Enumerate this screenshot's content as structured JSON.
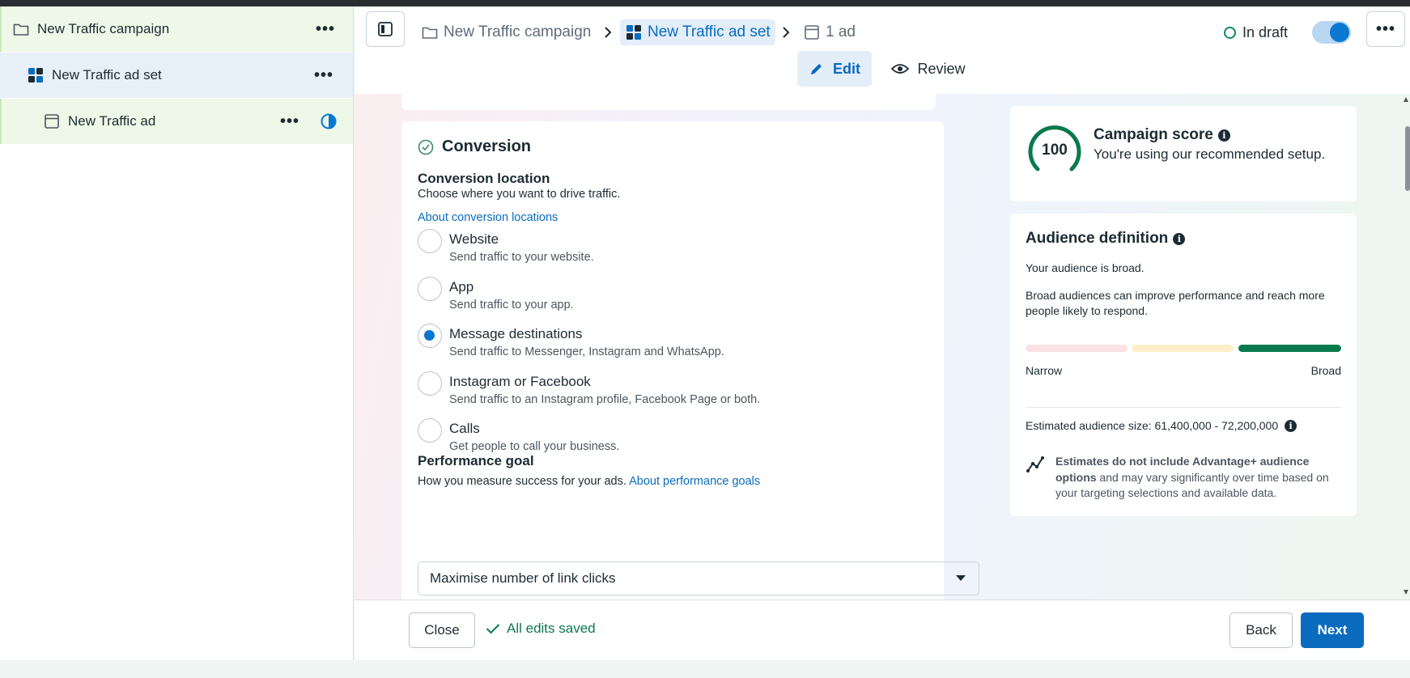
{
  "sidebar": {
    "items": [
      {
        "label": "New Traffic campaign",
        "icon": "folder-icon"
      },
      {
        "label": "New Traffic ad set",
        "icon": "grid-icon"
      },
      {
        "label": "New Traffic ad",
        "icon": "ad-window-icon"
      }
    ],
    "more_label": "•••"
  },
  "header": {
    "breadcrumbs": [
      {
        "label": "New Traffic campaign",
        "icon": "folder-icon"
      },
      {
        "label": "New Traffic ad set",
        "icon": "grid-icon"
      },
      {
        "label": "1 ad",
        "icon": "ad-window-icon"
      }
    ],
    "status": "In draft",
    "more_label": "•••",
    "tabs": [
      {
        "label": "Edit",
        "active": true
      },
      {
        "label": "Review",
        "active": false
      }
    ]
  },
  "conversion": {
    "title": "Conversion",
    "location_heading": "Conversion location",
    "location_sub": "Choose where you want to drive traffic.",
    "location_link": "About conversion locations",
    "options": [
      {
        "label": "Website",
        "desc": "Send traffic to your website.",
        "selected": false
      },
      {
        "label": "App",
        "desc": "Send traffic to your app.",
        "selected": false
      },
      {
        "label": "Message destinations",
        "desc": "Send traffic to Messenger, Instagram and WhatsApp.",
        "selected": true
      },
      {
        "label": "Instagram or Facebook",
        "desc": "Send traffic to an Instagram profile, Facebook Page or both.",
        "selected": false
      },
      {
        "label": "Calls",
        "desc": "Get people to call your business.",
        "selected": false
      }
    ],
    "goal_heading": "Performance goal",
    "goal_sub": "How you measure success for your ads.",
    "goal_link": "About performance goals",
    "goal_value": "Maximise number of link clicks"
  },
  "score": {
    "value": "100",
    "title": "Campaign score",
    "subtitle": "You're using our recommended setup."
  },
  "audience": {
    "title": "Audience definition",
    "line1": "Your audience is broad.",
    "line2": "Broad audiences can improve performance and reach more people likely to respond.",
    "narrow_label": "Narrow",
    "broad_label": "Broad",
    "level": "broad",
    "estimate_label": "Estimated audience size: 61,400,000 - 72,200,000",
    "note_bold1": "Estimates do not include Advantage+ audience options",
    "note_rest": " and may vary significantly over time based on your targeting selections and available data."
  },
  "footer": {
    "close_label": "Close",
    "saved_label": "All edits saved",
    "back_label": "Back",
    "next_label": "Next"
  },
  "colors": {
    "accent": "#0a6bbf",
    "success": "#0a7a4c"
  }
}
